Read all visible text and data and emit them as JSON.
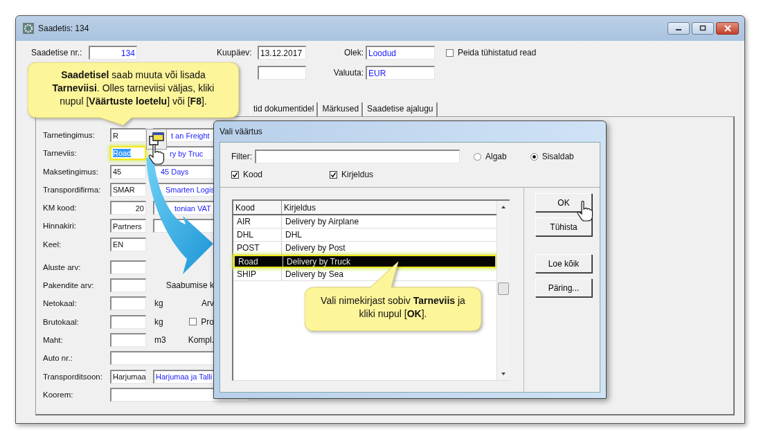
{
  "window": {
    "title": "Saadetis: 134"
  },
  "header": {
    "shipment_no": {
      "label": "Saadetise nr.:",
      "value": "134"
    },
    "date": {
      "label": "Kuupäev:",
      "value": "13.12.2017"
    },
    "status": {
      "label": "Olek:",
      "value": "Loodud"
    },
    "currency": {
      "label": "Valuuta:",
      "value": "EUR"
    },
    "hide_cancelled": {
      "label": "Peida tühistatud read",
      "checked": false
    }
  },
  "tabs": [
    {
      "label": "tid dokumentidel",
      "selected": false
    },
    {
      "label": "Märkused",
      "selected": false
    },
    {
      "label": "Saadetise ajalugu",
      "selected": false
    }
  ],
  "form": [
    {
      "kind": "lookup",
      "label": "Tarnetingimus:",
      "code": "R",
      "description": "t an Freight",
      "highlighted": false
    },
    {
      "kind": "lookup",
      "label": "Tarneviis:",
      "code": "Road",
      "description": "ry by Truc",
      "highlighted": true
    },
    {
      "kind": "lookup",
      "label": "Maksetingimus:",
      "code": "45",
      "description": "45 Days",
      "highlighted": false
    },
    {
      "kind": "lookup",
      "label": "Transpordifirma:",
      "code": "SMAR",
      "description": "Smarten Logis",
      "highlighted": false
    },
    {
      "kind": "lookup",
      "label": "KM kood:",
      "code": "20",
      "description": "tonian VAT",
      "highlighted": false
    },
    {
      "kind": "lookup",
      "label": "Hinnakiri:",
      "code": "Partners",
      "highlighted": false
    },
    {
      "kind": "field",
      "label": "Keel:",
      "value": "EN"
    },
    {
      "kind": "field",
      "label": "Aluste arv:"
    },
    {
      "kind": "field",
      "label": "Pakendite arv:",
      "extra": {
        "kind": "label",
        "label": "Saabumise k"
      }
    },
    {
      "kind": "field",
      "label": "Netokaal:",
      "unit": "kg",
      "extra": {
        "kind": "label",
        "label": "Arv"
      }
    },
    {
      "kind": "field",
      "label": "Brutokaal:",
      "unit": "kg",
      "extra": {
        "kind": "checkbox",
        "label": "Pro",
        "checked": false
      }
    },
    {
      "kind": "field",
      "label": "Maht:",
      "unit": "m3",
      "extra": {
        "kind": "label",
        "label": "Kompl."
      }
    },
    {
      "kind": "wide",
      "label": "Auto nr.:"
    },
    {
      "kind": "lookup",
      "label": "Transporditsoon:",
      "code": "Harjumaa",
      "description": "Harjumaa ja Talli",
      "highlighted": false
    },
    {
      "kind": "wide",
      "label": "Koorem:"
    }
  ],
  "dialog": {
    "title": "Vali väärtus",
    "filter": {
      "label": "Filter:"
    },
    "match": [
      {
        "label": "Algab",
        "selected": false
      },
      {
        "label": "Sisaldab",
        "selected": true
      }
    ],
    "search_in": [
      {
        "label": "Kood",
        "checked": true
      },
      {
        "label": "Kirjeldus",
        "checked": true
      }
    ],
    "columns": [
      "Kood",
      "Kirjeldus"
    ],
    "rows": [
      {
        "code": "AIR",
        "description": "Delivery by Airplane",
        "selected": false
      },
      {
        "code": "DHL",
        "description": "DHL",
        "selected": false
      },
      {
        "code": "POST",
        "description": "Delivery by Post",
        "selected": false
      },
      {
        "code": "Road",
        "description": "Delivery by Truck",
        "selected": true
      },
      {
        "code": "SHIP",
        "description": "Delivery by Sea",
        "selected": false
      }
    ],
    "buttons": [
      "OK",
      "Tühista",
      "Loe kõik",
      "Päring..."
    ]
  },
  "callouts": [
    {
      "text": "**Saadetisel** saab muuta või lisada **Tarneviisi**. Olles tarneviisi väljas, kliki nupul [**Väärtuste loetelu**] või [**F8**]."
    },
    {
      "text": "Vali nimekirjast sobiv **Tarneviis** ja kliki nupul [**OK**]."
    }
  ]
}
